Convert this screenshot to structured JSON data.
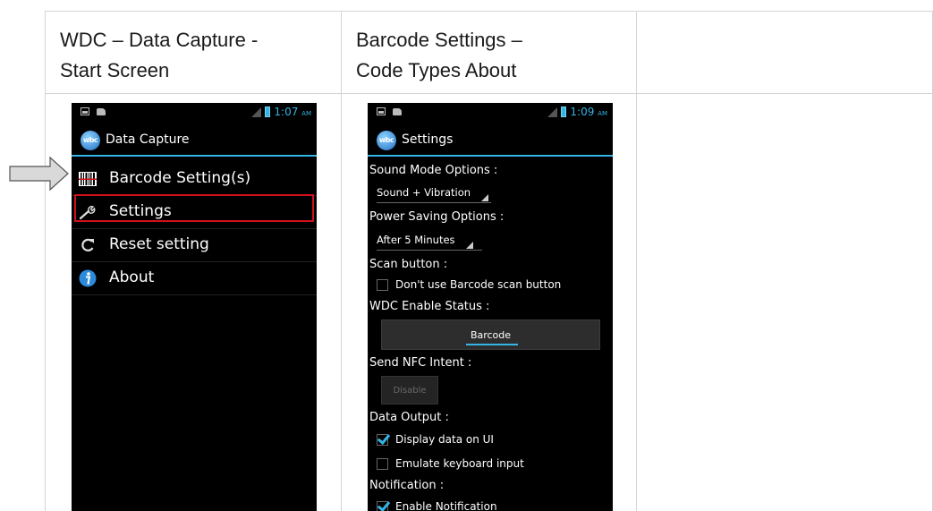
{
  "table": {
    "col1_header_line1": "WDC – Data Capture -",
    "col1_header_line2": "Start Screen",
    "col2_header_line1": "Barcode Settings –",
    "col2_header_line2": "Code Types About"
  },
  "screen1": {
    "status_time": "1:07",
    "status_ampm": "AM",
    "app_icon_text": "wbc",
    "title": "Data Capture",
    "menu": [
      {
        "label": "Barcode Setting(s)",
        "icon": "barcode-icon"
      },
      {
        "label": "Settings",
        "icon": "wrench-icon"
      },
      {
        "label": "Reset setting",
        "icon": "reset-icon"
      },
      {
        "label": "About",
        "icon": "info-icon"
      }
    ],
    "highlighted_item": "Settings",
    "pointer": "arrow-right-icon"
  },
  "screen2": {
    "status_time": "1:09",
    "status_ampm": "AM",
    "app_icon_text": "wbc",
    "title": "Settings",
    "sound_mode_label": "Sound Mode Options :",
    "sound_mode_value": "Sound + Vibration",
    "power_saving_label": "Power Saving Options :",
    "power_saving_value": "After 5 Minutes",
    "scan_button_label": "Scan button :",
    "scan_button_option": "Don't use Barcode scan button",
    "scan_button_checked": false,
    "wdc_enable_label": "WDC Enable Status :",
    "wdc_enable_button": "Barcode",
    "nfc_label": "Send NFC Intent :",
    "nfc_button": "Disable",
    "data_output_label": "Data Output :",
    "display_data_option": "Display data on UI",
    "display_data_checked": true,
    "emulate_keyboard_option": "Emulate keyboard input",
    "emulate_keyboard_checked": false,
    "notification_label": "Notification :",
    "notification_option": "Enable Notification",
    "notification_checked": true
  },
  "colors": {
    "accent": "#33b5e5",
    "highlight": "#d0101a",
    "grid": "#d4d4d4"
  }
}
